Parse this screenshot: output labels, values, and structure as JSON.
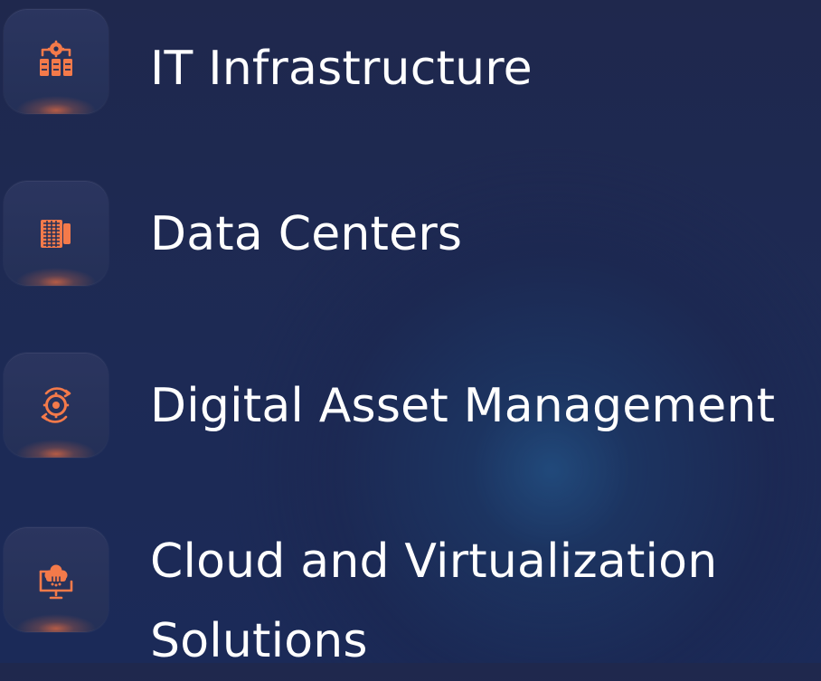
{
  "services": [
    {
      "label": "IT Infrastructure",
      "icon": "server-gear-icon"
    },
    {
      "label": "Data Centers",
      "icon": "data-center-building-icon"
    },
    {
      "label": "Digital Asset Management",
      "icon": "gear-sync-icon"
    },
    {
      "label": "Cloud and Virtualization Solutions",
      "icon": "cloud-monitor-icon"
    }
  ],
  "colors": {
    "accent": "#f47a4a",
    "text": "#ffffff",
    "background": "#1f284d"
  }
}
